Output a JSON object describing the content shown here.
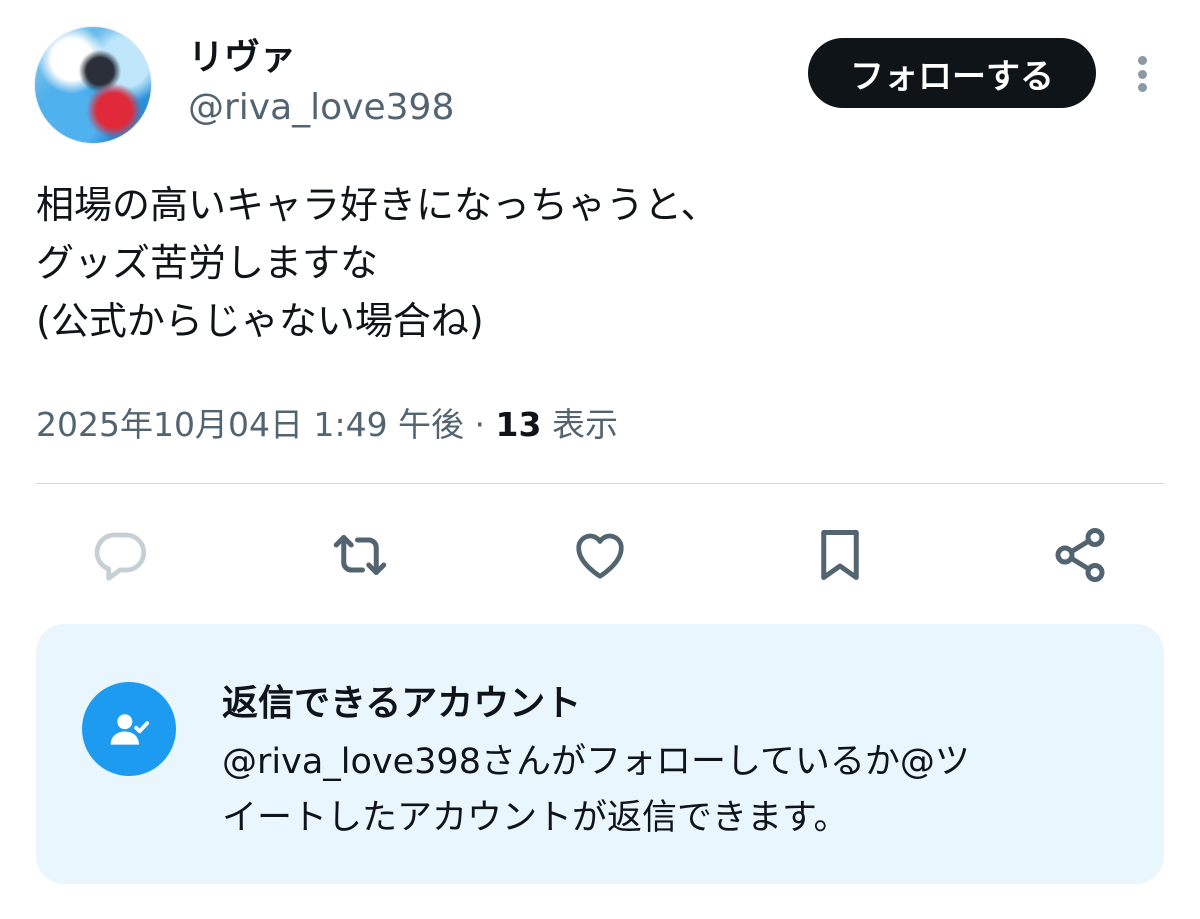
{
  "author": {
    "display_name": "リヴァ",
    "handle": "@riva_love398",
    "avatar_icon": "anime-character-avatar"
  },
  "follow_button": {
    "label": "フォローする"
  },
  "more_menu": {
    "icon": "more-vertical-icon"
  },
  "tweet": {
    "lines": [
      "相場の高いキャラ好きになっちゃうと、",
      "グッズ苦労しますな",
      "(公式からじゃない場合ね)"
    ]
  },
  "meta": {
    "timestamp": "2025年10月04日 1:49 午後",
    "separator": " · ",
    "views_count": "13",
    "views_label": "表示"
  },
  "actions": [
    {
      "name": "reply",
      "icon": "reply-icon"
    },
    {
      "name": "retweet",
      "icon": "retweet-icon"
    },
    {
      "name": "like",
      "icon": "heart-icon"
    },
    {
      "name": "bookmark",
      "icon": "bookmark-icon"
    },
    {
      "name": "share",
      "icon": "share-icon"
    }
  ],
  "reply_restriction": {
    "icon": "user-check-icon",
    "title": "返信できるアカウント",
    "description_lines": [
      "@riva_love398さんがフォローしているか@ツ",
      "イートしたアカウントが返信できます。"
    ]
  },
  "colors": {
    "text": "#0f1419",
    "secondary_text": "#536471",
    "accent": "#1d9bf0",
    "card_background": "#eaf6fd",
    "follow_button": "#0f1419"
  }
}
